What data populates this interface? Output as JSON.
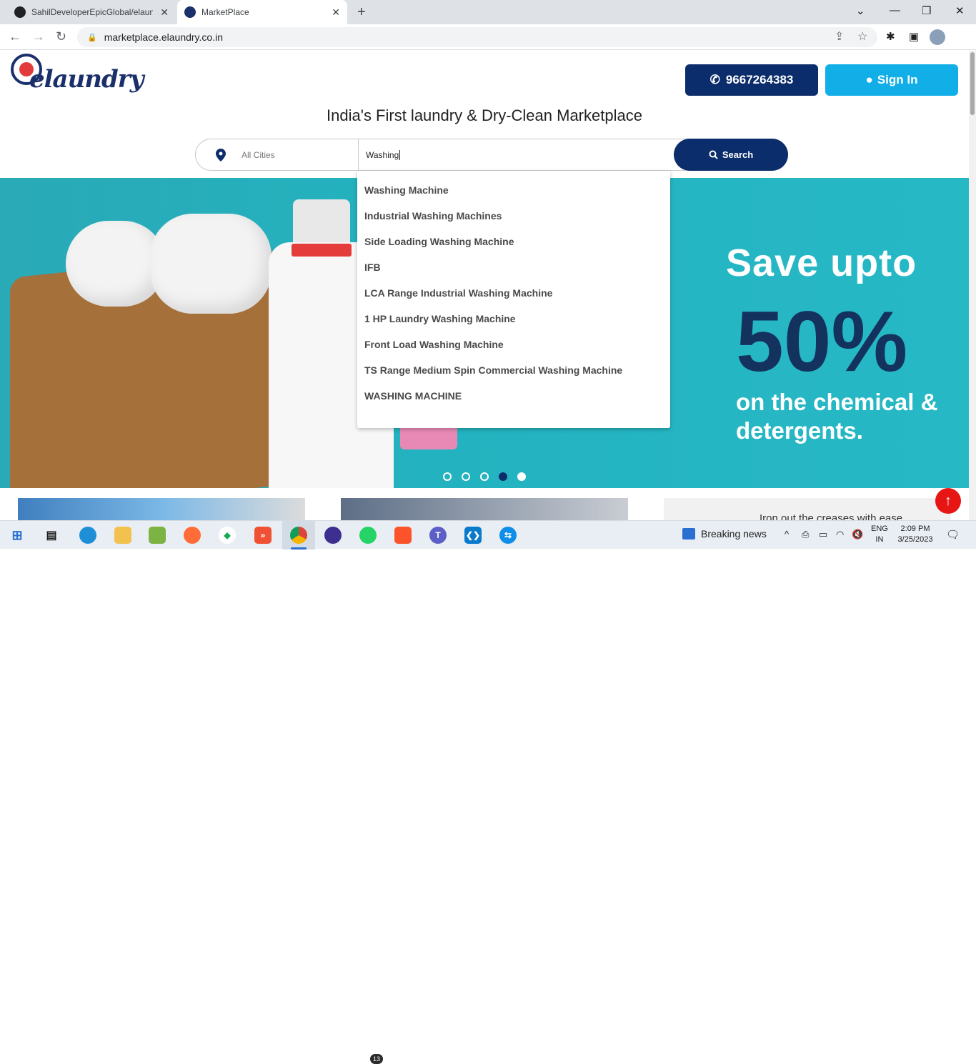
{
  "browser": {
    "tabs": [
      {
        "title": "SahilDeveloperEpicGlobal/elaund"
      },
      {
        "title": "MarketPlace"
      }
    ],
    "url": "marketplace.elaundry.co.in"
  },
  "header": {
    "logo_text": "elaundry",
    "phone": "9667264383",
    "signin_label": "Sign In"
  },
  "tagline": "India's First laundry & Dry-Clean Marketplace",
  "search": {
    "city_placeholder": "All Cities",
    "query_value": "Washing",
    "button_label": "Search",
    "suggestions": [
      "Washing Machine",
      "Industrial Washing Machines",
      "Side Loading Washing Machine",
      "IFB",
      "LCA Range Industrial Washing Machine",
      "1 HP Laundry Washing Machine",
      "Front Load Washing Machine",
      "TS Range Medium Spin Commercial Washing Machine",
      "WASHING MACHINE"
    ]
  },
  "banner": {
    "line1": "Save upto",
    "big": "50%",
    "line2": "on the chemical & detergents.",
    "slide_count": 5,
    "active_slide": 4
  },
  "cards": {
    "card3_text": "Iron out the creases with ease"
  },
  "taskbar": {
    "news_label": "Breaking news",
    "whatsapp_badge": "13",
    "lang_line1": "ENG",
    "lang_line2": "IN",
    "time": "2:09 PM",
    "date": "3/25/2023"
  },
  "colors": {
    "navy": "#0c2d6b",
    "sky": "#12aee8",
    "banner_teal": "#23b3c0",
    "totop_red": "#e81515"
  }
}
